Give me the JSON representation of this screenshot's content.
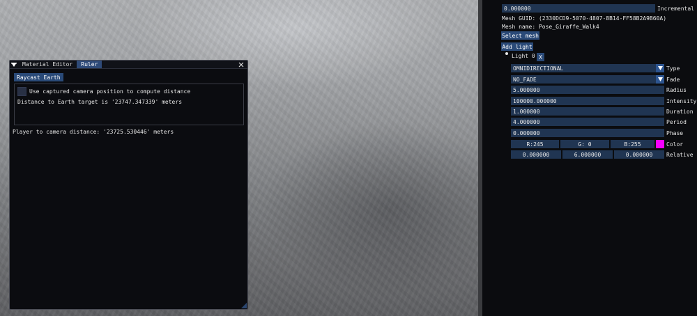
{
  "editor": {
    "tabs": [
      {
        "label": "Material Editor"
      },
      {
        "label": "Ruler"
      }
    ],
    "raycast_button": "Raycast Earth",
    "use_camera_label": "Use captured camera position to compute distance",
    "distance_to_earth": "Distance to Earth target is '23747.347339' meters",
    "player_distance": "Player to camera distance: '23725.530446' meters"
  },
  "panel": {
    "incremental_value": "0.000000",
    "incremental_label": "Incremental p",
    "mesh_guid": "Mesh GUID: (2330DCD9-5070-4807-8B14-FF58B2A9B60A)",
    "mesh_name": "Mesh name: Pose_Giraffe_Walk4",
    "select_mesh": "Select mesh",
    "add_light": "Add light",
    "light_node": "Light 0",
    "remove_light": "X",
    "type_value": "OMNIDIRECTIONAL",
    "type_label": "Type",
    "fade_value": "NO_FADE",
    "fade_label": "Fade",
    "radius_value": "5.000000",
    "radius_label": "Radius",
    "intensity_value": "100000.000000",
    "intensity_label": "Intensity",
    "duration_value": "1.000000",
    "duration_label": "Duration",
    "period_value": "4.000000",
    "period_label": "Period",
    "phase_value": "0.000000",
    "phase_label": "Phase",
    "color_r": "R:245",
    "color_g": "G:  0",
    "color_b": "B:255",
    "color_label": "Color",
    "color_hex": "#f500ff",
    "pos_x": "0.000000",
    "pos_y": "6.000000",
    "pos_z": "0.000000",
    "relative_label": "Relative p"
  },
  "icons": {
    "menu": "caret-down-icon",
    "close": "close-icon",
    "dropdown": "triangle-down-icon",
    "bullet": "bullet-icon",
    "grip": "resize-grip-icon"
  }
}
